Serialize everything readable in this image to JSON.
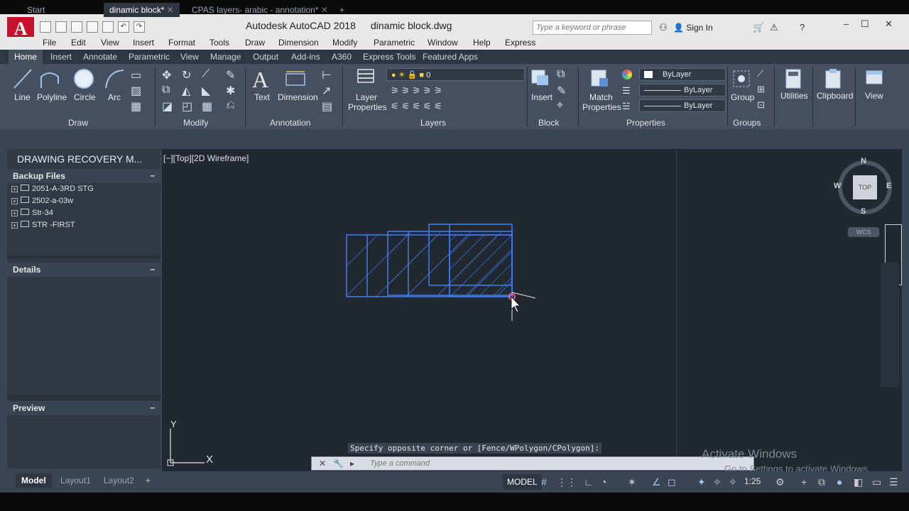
{
  "window": {
    "app_title": "Autodesk AutoCAD 2018",
    "file_title": "dinamic block.dwg",
    "search_placeholder": "Type a keyword or phrase",
    "sign_in": "Sign In"
  },
  "menu": [
    "File",
    "Edit",
    "View",
    "Insert",
    "Format",
    "Tools",
    "Draw",
    "Dimension",
    "Modify",
    "Parametric",
    "Window",
    "Help",
    "Express"
  ],
  "ribbon_tabs": [
    "Home",
    "Insert",
    "Annotate",
    "Parametric",
    "View",
    "Manage",
    "Output",
    "Add-ins",
    "A360",
    "Express Tools",
    "Featured Apps"
  ],
  "ribbon": {
    "draw_tools": [
      "Line",
      "Polyline",
      "Circle",
      "Arc"
    ],
    "annotation_tools": [
      "Text",
      "Dimension"
    ],
    "layer_props": "Layer\nProperties",
    "layer_value": "0",
    "insert": "Insert",
    "match_properties": "Match\nProperties",
    "bylayer": "ByLayer",
    "group": "Group",
    "utilities": "Utilities",
    "clipboard": "Clipboard",
    "view": "View",
    "panels": {
      "draw": "Draw",
      "modify": "Modify",
      "annotation": "Annotation",
      "layers": "Layers",
      "block": "Block",
      "properties": "Properties",
      "groups": "Groups"
    }
  },
  "doc_tabs": [
    "Start",
    "dinamic block*",
    "CPAS layers- arabic - annotation*"
  ],
  "recovery": {
    "title": "DRAWING RECOVERY M...",
    "backup_header": "Backup Files",
    "files": [
      "2051-A-3RD STG",
      "2502-a-03w",
      "Str-34",
      "STR -FIRST"
    ],
    "details_header": "Details",
    "preview_header": "Preview"
  },
  "canvas": {
    "view_label": "[−][Top][2D Wireframe]",
    "command_prompt": "Specify opposite corner or [Fence/WPolygon/CPolygon]:",
    "command_placeholder": "Type a command",
    "viewcube_top": "TOP",
    "compass": {
      "n": "N",
      "s": "S",
      "e": "E",
      "w": "W"
    },
    "wcs": "WCS",
    "ucs_x": "X",
    "ucs_y": "Y"
  },
  "watermark": {
    "line1": "Activate Windows",
    "line2": "Go to Settings to activate Windows."
  },
  "layout_tabs": [
    "Model",
    "Layout1",
    "Layout2"
  ],
  "status": {
    "model": "MODEL",
    "scale": "1:25"
  },
  "colors": {
    "accent_red": "#c8102e",
    "drawing_blue": "#3f7df5",
    "canvas_bg": "#212830"
  }
}
